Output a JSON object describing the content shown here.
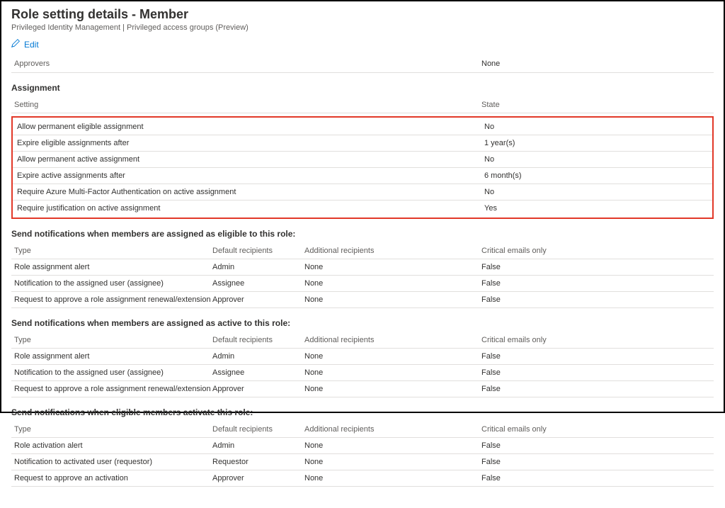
{
  "header": {
    "title": "Role setting details - Member",
    "breadcrumb": "Privileged Identity Management | Privileged access groups (Preview)",
    "edit_label": "Edit"
  },
  "approvers": {
    "label": "Approvers",
    "value": "None"
  },
  "assignment": {
    "title": "Assignment",
    "col_setting": "Setting",
    "col_state": "State",
    "rows": [
      {
        "setting": "Allow permanent eligible assignment",
        "state": "No"
      },
      {
        "setting": "Expire eligible assignments after",
        "state": "1 year(s)"
      },
      {
        "setting": "Allow permanent active assignment",
        "state": "No"
      },
      {
        "setting": "Expire active assignments after",
        "state": "6 month(s)"
      },
      {
        "setting": "Require Azure Multi-Factor Authentication on active assignment",
        "state": "No"
      },
      {
        "setting": "Require justification on active assignment",
        "state": "Yes"
      }
    ]
  },
  "notif_cols": {
    "type": "Type",
    "default": "Default recipients",
    "addl": "Additional recipients",
    "crit": "Critical emails only"
  },
  "notif_eligible": {
    "title": "Send notifications when members are assigned as eligible to this role:",
    "rows": [
      {
        "type": "Role assignment alert",
        "default": "Admin",
        "addl": "None",
        "crit": "False"
      },
      {
        "type": "Notification to the assigned user (assignee)",
        "default": "Assignee",
        "addl": "None",
        "crit": "False"
      },
      {
        "type": "Request to approve a role assignment renewal/extension",
        "default": "Approver",
        "addl": "None",
        "crit": "False"
      }
    ]
  },
  "notif_active": {
    "title": "Send notifications when members are assigned as active to this role:",
    "rows": [
      {
        "type": "Role assignment alert",
        "default": "Admin",
        "addl": "None",
        "crit": "False"
      },
      {
        "type": "Notification to the assigned user (assignee)",
        "default": "Assignee",
        "addl": "None",
        "crit": "False"
      },
      {
        "type": "Request to approve a role assignment renewal/extension",
        "default": "Approver",
        "addl": "None",
        "crit": "False"
      }
    ]
  },
  "notif_activate": {
    "title": "Send notifications when eligible members activate this role:",
    "rows": [
      {
        "type": "Role activation alert",
        "default": "Admin",
        "addl": "None",
        "crit": "False"
      },
      {
        "type": "Notification to activated user (requestor)",
        "default": "Requestor",
        "addl": "None",
        "crit": "False"
      },
      {
        "type": "Request to approve an activation",
        "default": "Approver",
        "addl": "None",
        "crit": "False"
      }
    ]
  }
}
